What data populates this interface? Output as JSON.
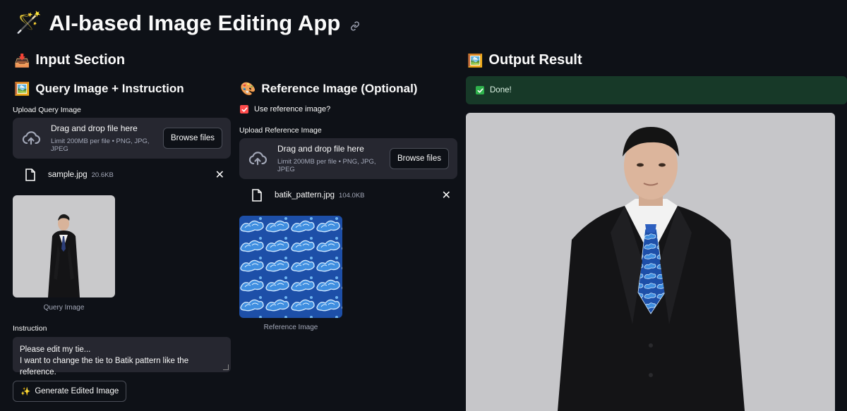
{
  "app": {
    "title": "AI-based Image Editing App",
    "title_emoji": "🪄",
    "link_icon": "link-icon"
  },
  "input_section": {
    "title": "Input Section",
    "emoji": "📥"
  },
  "query": {
    "title": "Query Image + Instruction",
    "emoji": "🖼️",
    "upload_label": "Upload Query Image",
    "dropzone_title": "Drag and drop file here",
    "dropzone_sub": "Limit 200MB per file • PNG, JPG, JPEG",
    "browse_label": "Browse files",
    "file_name": "sample.jpg",
    "file_size": "20.6KB",
    "caption": "Query Image",
    "instruction_label": "Instruction",
    "instruction_value": "Please edit my tie...\nI want to change the tie to Batik pattern like the reference.",
    "generate_label": "Generate Edited Image",
    "generate_emoji": "✨"
  },
  "reference": {
    "title": "Reference Image (Optional)",
    "emoji": "🎨",
    "checkbox_label": "Use reference image?",
    "checkbox_checked": true,
    "upload_label": "Upload Reference Image",
    "dropzone_title": "Drag and drop file here",
    "dropzone_sub": "Limit 200MB per file • PNG, JPG, JPEG",
    "browse_label": "Browse files",
    "file_name": "batik_pattern.jpg",
    "file_size": "104.0KB",
    "caption": "Reference Image"
  },
  "output": {
    "title": "Output Result",
    "emoji": "🖼️",
    "status": "Done!"
  },
  "colors": {
    "background": "#0e1117",
    "widget": "#262730",
    "accent": "#ff4b4b",
    "success_bg": "#173928",
    "success_icon": "#2fb24c"
  }
}
